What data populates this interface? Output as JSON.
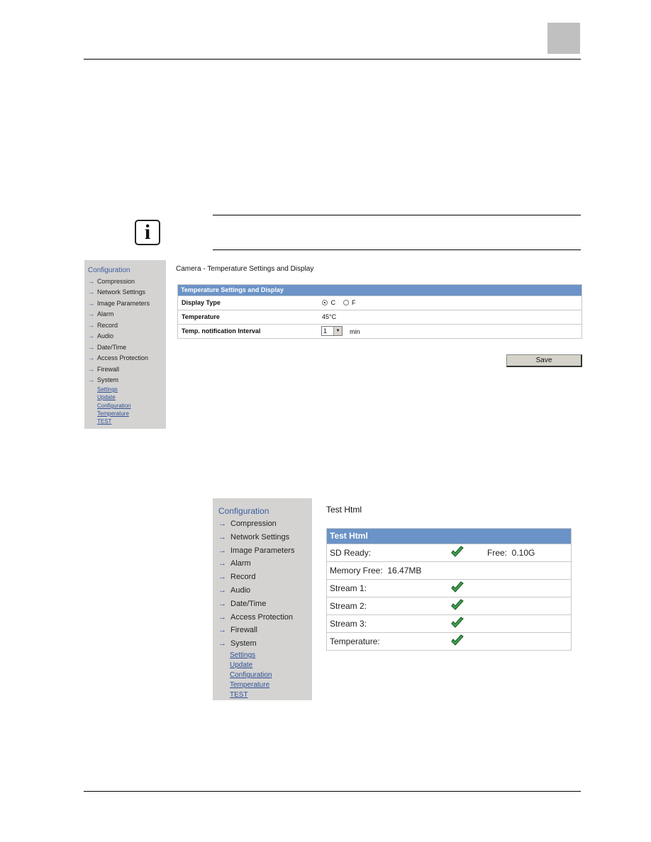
{
  "page": {
    "note_icon": "info-icon"
  },
  "panel1": {
    "sidebar": {
      "title": "Configuration",
      "items": [
        "Compression",
        "Network Settings",
        "Image Parameters",
        "Alarm",
        "Record",
        "Audio",
        "Date/Time",
        "Access Protection",
        "Firewall",
        "System"
      ],
      "sub_items": [
        "Settings",
        "Update",
        "Configuration",
        "Temperature",
        "TEST"
      ]
    },
    "page_title": "Camera - Temperature Settings and Display",
    "table_header": "Temperature Settings and Display",
    "rows": {
      "display_type": {
        "label": "Display Type",
        "options": [
          "C",
          "F"
        ],
        "selected": "C"
      },
      "temperature": {
        "label": "Temperature",
        "value": "45°C"
      },
      "interval": {
        "label": "Temp. notification Interval",
        "value": "1",
        "unit": "min"
      }
    },
    "save_label": "Save"
  },
  "panel2": {
    "sidebar": {
      "title": "Configuration",
      "items": [
        "Compression",
        "Network Settings",
        "Image Parameters",
        "Alarm",
        "Record",
        "Audio",
        "Date/Time",
        "Access Protection",
        "Firewall",
        "System"
      ],
      "sub_items": [
        "Settings",
        "Update",
        "Configuration",
        "Temperature",
        "TEST"
      ]
    },
    "page_title": "Test Html",
    "table_header": "Test Html",
    "rows": [
      {
        "label": "SD Ready:",
        "check": true,
        "extra": "Free:  0.10G"
      },
      {
        "label": "Memory Free:  16.47MB",
        "check": false,
        "extra": ""
      },
      {
        "label": "Stream 1:",
        "check": true,
        "extra": ""
      },
      {
        "label": "Stream 2:",
        "check": true,
        "extra": ""
      },
      {
        "label": "Stream 3:",
        "check": true,
        "extra": ""
      },
      {
        "label": "Temperature:",
        "check": true,
        "extra": ""
      }
    ]
  },
  "colors": {
    "header_blue": "#6b93c7",
    "sidebar_bg": "#d4d3d2",
    "link_blue": "#2d4f92",
    "check_green": "#3fa34d"
  }
}
